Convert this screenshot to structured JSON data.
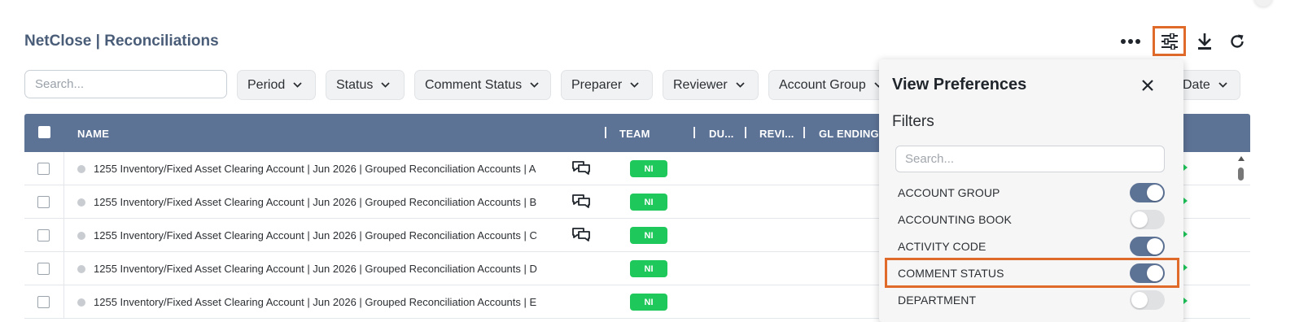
{
  "header": {
    "title": "NetClose | Reconciliations"
  },
  "toolbar": {
    "more_icon": "more-horizontal-icon",
    "prefs_icon": "sliders-icon",
    "download_icon": "download-icon",
    "refresh_icon": "refresh-icon",
    "highlight_color": "#e06a2a"
  },
  "search": {
    "placeholder": "Search..."
  },
  "filters": [
    {
      "label": "Period"
    },
    {
      "label": "Status"
    },
    {
      "label": "Comment Status"
    },
    {
      "label": "Preparer"
    },
    {
      "label": "Reviewer"
    },
    {
      "label": "Account Group"
    },
    {
      "label": "Date"
    }
  ],
  "table": {
    "header_color": "#5d7396",
    "columns": {
      "name": "NAME",
      "team": "TEAM",
      "due": "DU...",
      "reviewer": "REVI...",
      "gl_ending": "GL ENDING"
    },
    "rows": [
      {
        "name": "1255 Inventory/Fixed Asset Clearing Account | Jun 2026 | Grouped Reconciliation Accounts | A",
        "team": "NI",
        "has_comment": true
      },
      {
        "name": "1255 Inventory/Fixed Asset Clearing Account | Jun 2026 | Grouped Reconciliation Accounts | B",
        "team": "NI",
        "has_comment": true
      },
      {
        "name": "1255 Inventory/Fixed Asset Clearing Account | Jun 2026 | Grouped Reconciliation Accounts | C",
        "team": "NI",
        "has_comment": true
      },
      {
        "name": "1255 Inventory/Fixed Asset Clearing Account | Jun 2026 | Grouped Reconciliation Accounts | D",
        "team": "NI",
        "has_comment": false
      },
      {
        "name": "1255 Inventory/Fixed Asset Clearing Account | Jun 2026 | Grouped Reconciliation Accounts | E",
        "team": "NI",
        "has_comment": false
      }
    ],
    "team_badge_color": "#1ec85a"
  },
  "view_preferences": {
    "title": "View Preferences",
    "section": "Filters",
    "search_placeholder": "Search...",
    "items": [
      {
        "label": "ACCOUNT GROUP",
        "enabled": true
      },
      {
        "label": "ACCOUNTING BOOK",
        "enabled": false
      },
      {
        "label": "ACTIVITY CODE",
        "enabled": true
      },
      {
        "label": "COMMENT STATUS",
        "enabled": true,
        "highlighted": true
      },
      {
        "label": "DEPARTMENT",
        "enabled": false
      }
    ],
    "toggle_on_color": "#5d7396"
  }
}
